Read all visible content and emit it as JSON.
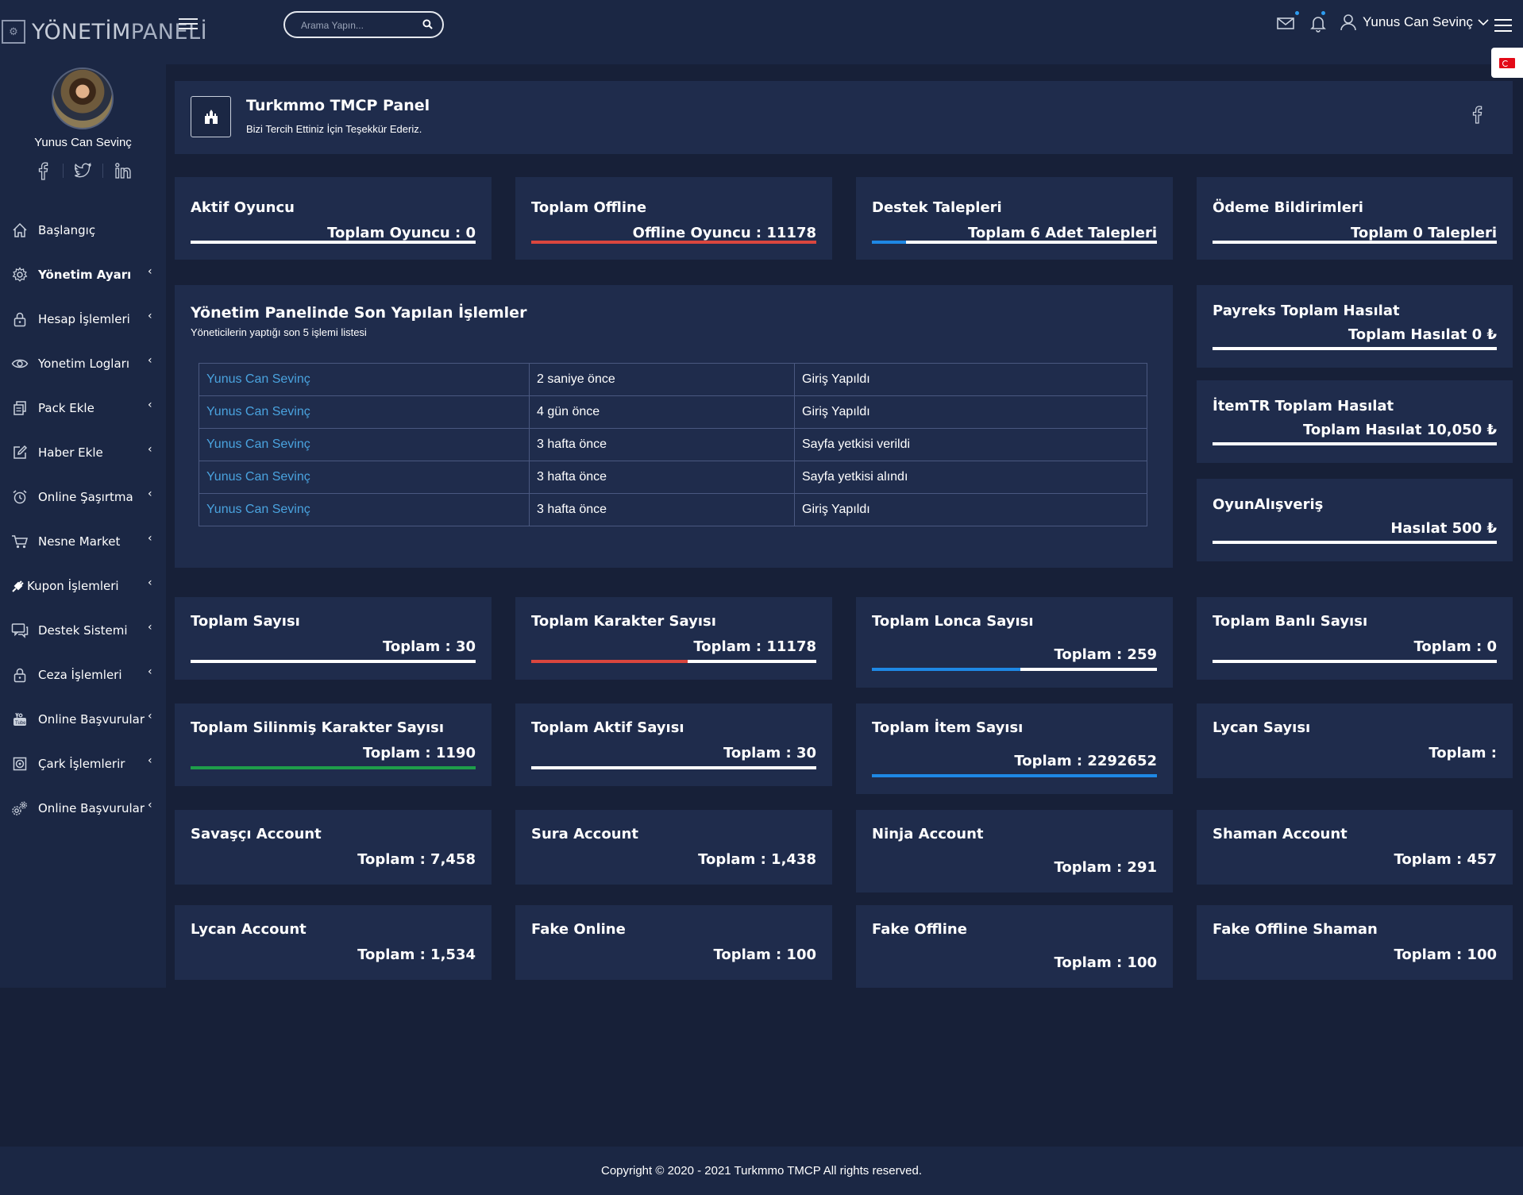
{
  "app": {
    "logo_main": "YÖNETİM",
    "logo_thin": "PANELİ"
  },
  "header": {
    "search_placeholder": "Arama Yapın...",
    "user_name": "Yunus Can Sevinç"
  },
  "sidebar": {
    "profile_name": "Yunus Can Sevinç",
    "items": [
      {
        "label": "Başlangıç",
        "icon": "home-icon",
        "arrow": false
      },
      {
        "label": "Yönetim Ayarı",
        "icon": "gear-icon",
        "arrow": true
      },
      {
        "label": "Hesap İşlemleri",
        "icon": "lock-icon",
        "arrow": true
      },
      {
        "label": "Yonetim Logları",
        "icon": "eye-icon",
        "arrow": true
      },
      {
        "label": "Pack Ekle",
        "icon": "copy-icon",
        "arrow": true
      },
      {
        "label": "Haber Ekle",
        "icon": "edit-icon",
        "arrow": true
      },
      {
        "label": "Online Şaşırtma",
        "icon": "alarm-icon",
        "arrow": true
      },
      {
        "label": "Nesne Market",
        "icon": "cart-icon",
        "arrow": true
      },
      {
        "label": "Kupon İşlemleri",
        "icon": "plug-icon",
        "arrow": true
      },
      {
        "label": "Destek Sistemi",
        "icon": "chat-icon",
        "arrow": true
      },
      {
        "label": "Ceza İşlemleri",
        "icon": "lock-icon",
        "arrow": true
      },
      {
        "label": "Online Başvurular",
        "icon": "youtube-icon",
        "arrow": true
      },
      {
        "label": "Çark İşlemlerir",
        "icon": "target-icon",
        "arrow": true
      },
      {
        "label": "Online Başvurular",
        "icon": "gears-icon",
        "arrow": true
      }
    ]
  },
  "intro": {
    "title": "Turkmmo TMCP Panel",
    "subtitle": "Bizi Tercih Ettiniz İçin Teşekkür Ederiz."
  },
  "stats_top": [
    {
      "title": "Aktif Oyuncu",
      "value": "Toplam Oyuncu : 0",
      "progress": 0,
      "color": "#ffffff"
    },
    {
      "title": "Toplam Offline",
      "value": "Offline Oyuncu : 11178",
      "progress": 100,
      "color": "#d9463e"
    },
    {
      "title": "Destek Talepleri",
      "value": "Toplam 6 Adet Talepleri",
      "progress": 12,
      "color": "#1e88e5"
    },
    {
      "title": "Ödeme Bildirimleri",
      "value": "Toplam 0 Talepleri",
      "progress": 0,
      "color": "#ffffff"
    }
  ],
  "recent": {
    "title": "Yönetim Panelinde Son Yapılan İşlemler",
    "subtitle": "Yöneticilerin yaptığı son 5 işlemi listesi",
    "rows": [
      {
        "user": "Yunus Can Sevinç",
        "time": "2 saniye önce",
        "action": "Giriş Yapıldı"
      },
      {
        "user": "Yunus Can Sevinç",
        "time": "4 gün önce",
        "action": "Giriş Yapıldı"
      },
      {
        "user": "Yunus Can Sevinç",
        "time": "3 hafta önce",
        "action": "Sayfa yetkisi verildi"
      },
      {
        "user": "Yunus Can Sevinç",
        "time": "3 hafta önce",
        "action": "Sayfa yetkisi alındı"
      },
      {
        "user": "Yunus Can Sevinç",
        "time": "3 hafta önce",
        "action": "Giriş Yapıldı"
      }
    ]
  },
  "revenue": [
    {
      "title": "Payreks Toplam Hasılat",
      "value": "Toplam Hasılat 0 ₺"
    },
    {
      "title": "İtemTR Toplam Hasılat",
      "value": "Toplam Hasılat 10,050 ₺"
    },
    {
      "title": "OyunAlışveriş",
      "value": "Hasılat 500 ₺"
    }
  ],
  "stats_mid": [
    {
      "title": "Toplam Sayısı",
      "value": "Toplam : 30",
      "progress": 0,
      "color": "#ffffff"
    },
    {
      "title": "Toplam Karakter Sayısı",
      "value": "Toplam : 11178",
      "progress": 55,
      "color": "#d9463e"
    },
    {
      "title": "Toplam Lonca Sayısı",
      "value": "Toplam : 259",
      "progress": 52,
      "color": "#1e88e5"
    },
    {
      "title": "Toplam Banlı Sayısı",
      "value": "Toplam : 0",
      "progress": 0,
      "color": "#ffffff"
    },
    {
      "title": "Toplam Silinmiş Karakter Sayısı",
      "value": "Toplam : 1190",
      "progress": 100,
      "color": "#1e9e4a"
    },
    {
      "title": "Toplam Aktif Sayısı",
      "value": "Toplam : 30",
      "progress": 0,
      "color": "#ffffff"
    },
    {
      "title": "Toplam İtem Sayısı",
      "value": "Toplam : 2292652",
      "progress": 100,
      "color": "#1e88e5"
    },
    {
      "title": "Lycan Sayısı",
      "value": "Toplam :",
      "progress": null,
      "color": "#ffffff"
    }
  ],
  "accounts": [
    {
      "title": "Savaşçı Account",
      "value": "Toplam : 7,458"
    },
    {
      "title": "Sura Account",
      "value": "Toplam : 1,438"
    },
    {
      "title": "Ninja Account",
      "value": "Toplam : 291"
    },
    {
      "title": "Shaman Account",
      "value": "Toplam : 457"
    },
    {
      "title": "Lycan Account",
      "value": "Toplam : 1,534"
    },
    {
      "title": "Fake Online",
      "value": "Toplam : 100"
    },
    {
      "title": "Fake Offline",
      "value": "Toplam : 100"
    },
    {
      "title": "Fake Offline Shaman",
      "value": "Toplam : 100"
    }
  ],
  "footer": {
    "text": "Copyright © 2020 - 2021 Turkmmo TMCP All rights reserved."
  }
}
